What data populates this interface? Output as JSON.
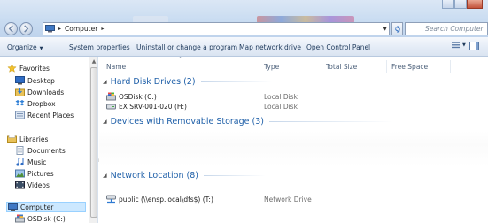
{
  "address": {
    "root_arrow": "▸",
    "location": "Computer",
    "trail_arrow": "▸"
  },
  "search": {
    "placeholder": "Search Computer"
  },
  "commandbar": {
    "organize": "Organize",
    "system_properties": "System properties",
    "uninstall": "Uninstall or change a program",
    "map_drive": "Map network drive",
    "control_panel": "Open Control Panel"
  },
  "nav": {
    "favorites": {
      "label": "Favorites",
      "items": [
        "Desktop",
        "Downloads",
        "Dropbox",
        "Recent Places"
      ]
    },
    "libraries": {
      "label": "Libraries",
      "items": [
        "Documents",
        "Music",
        "Pictures",
        "Videos"
      ]
    },
    "computer": {
      "label": "Computer",
      "items": [
        "OSDisk (C:)"
      ]
    }
  },
  "columns": {
    "name": "Name",
    "type": "Type",
    "total_size": "Total Size",
    "free_space": "Free Space"
  },
  "groups": {
    "hdd": {
      "title": "Hard Disk Drives (2)",
      "items": [
        {
          "name": "OSDisk (C:)",
          "type": "Local Disk"
        },
        {
          "name": "EX SRV-001-020 (H:)",
          "type": "Local Disk"
        }
      ]
    },
    "removable": {
      "title": "Devices with Removable Storage (3)"
    },
    "network": {
      "title": "Network Location (8)",
      "items": [
        {
          "name": "public (\\\\ensp.local\\dfs$) (T:)",
          "type": "Network Drive"
        }
      ]
    }
  },
  "colors": {
    "accent": "#1e5fa8",
    "selection": "#cce8ff"
  }
}
